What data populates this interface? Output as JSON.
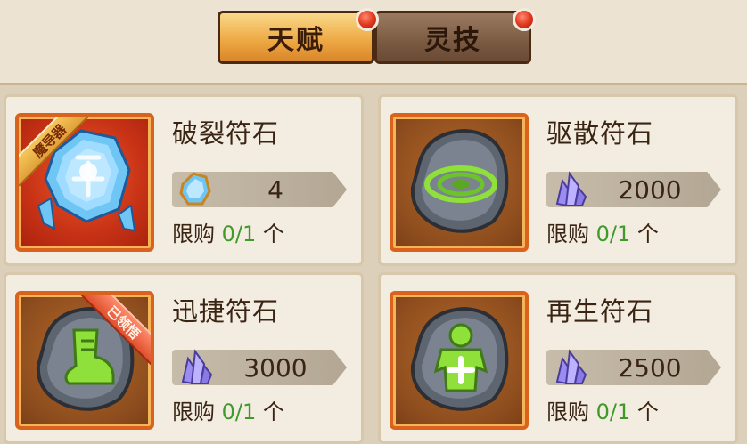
{
  "tabs": [
    {
      "label": "天赋",
      "active": true,
      "has_badge": true
    },
    {
      "label": "灵技",
      "active": false,
      "has_badge": true
    }
  ],
  "items": [
    {
      "name": "破裂符石",
      "price": "4",
      "currency_icon": "blue-crystal-icon",
      "limit_label": "限购",
      "limit_count": "0/1",
      "limit_unit": "个",
      "ribbon": "魔导器",
      "art": "blue-crystal-rune-icon"
    },
    {
      "name": "驱散符石",
      "price": "2000",
      "currency_icon": "purple-crystal-icon",
      "limit_label": "限购",
      "limit_count": "0/1",
      "limit_unit": "个",
      "ribbon": "",
      "art": "swirl-rune-stone-icon"
    },
    {
      "name": "迅捷符石",
      "price": "3000",
      "currency_icon": "purple-crystal-icon",
      "limit_label": "限购",
      "limit_count": "0/1",
      "limit_unit": "个",
      "ribbon": "已领悟",
      "art": "boot-rune-stone-icon"
    },
    {
      "name": "再生符石",
      "price": "2500",
      "currency_icon": "purple-crystal-icon",
      "limit_label": "限购",
      "limit_count": "0/1",
      "limit_unit": "个",
      "ribbon": "",
      "art": "heal-rune-stone-icon"
    }
  ],
  "colors": {
    "accent_orange": "#eeaa45",
    "frame_orange": "#d9631c",
    "limit_green": "#3f9a2a",
    "badge_red": "#e23a20"
  }
}
